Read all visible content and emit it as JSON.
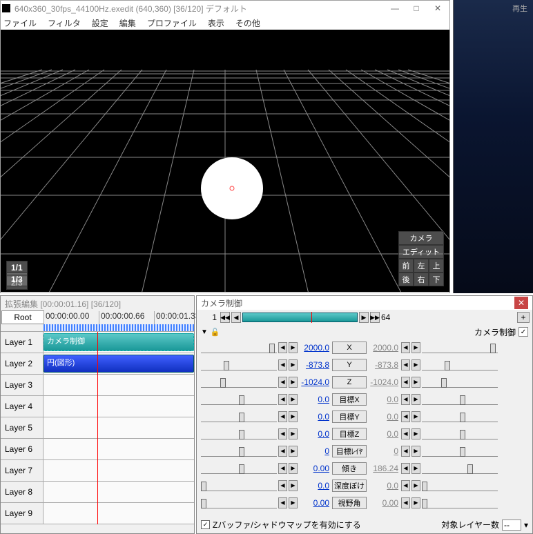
{
  "main": {
    "title": "640x360_30fps_44100Hz.exedit (640,360) [36/120] デフォルト",
    "menu": {
      "file": "ファイル",
      "filter": "フィルタ",
      "settings": "設定",
      "edit": "編集",
      "profile": "プロファイル",
      "view": "表示",
      "other": "その他"
    }
  },
  "side": {
    "label": "再生"
  },
  "viewport": {
    "badges_left": [
      "1/1",
      "2/3",
      "1/3"
    ],
    "camera_label": "カメラ",
    "edit_label": "エディット",
    "nav": {
      "front": "前",
      "left": "左",
      "top": "上",
      "back": "後",
      "right": "右",
      "bottom": "下"
    }
  },
  "timeline": {
    "title": "拡張編集 [00:00:01.16] [36/120]",
    "root": "Root",
    "ticks": [
      "00:00:00.00",
      "00:00:00.66",
      "00:00:01.33"
    ],
    "layers": [
      "Layer 1",
      "Layer 2",
      "Layer 3",
      "Layer 4",
      "Layer 5",
      "Layer 6",
      "Layer 7",
      "Layer 8",
      "Layer 9"
    ],
    "clip_cam": "カメラ制御",
    "clip_shape": "円(図形)"
  },
  "panel": {
    "title": "カメラ制御",
    "frame_start": "1",
    "frame_end": "64",
    "sub_label": "カメラ制御",
    "params": [
      {
        "label": "X",
        "l": "2000.0",
        "r": "2000.0",
        "lg": false,
        "rg": true,
        "lp": 90,
        "rp": 90
      },
      {
        "label": "Y",
        "l": "-873.8",
        "r": "-873.8",
        "lg": false,
        "rg": true,
        "lp": 30,
        "rp": 30
      },
      {
        "label": "Z",
        "l": "-1024.0",
        "r": "-1024.0",
        "lg": false,
        "rg": true,
        "lp": 25,
        "rp": 25
      },
      {
        "label": "目標X",
        "l": "0.0",
        "r": "0.0",
        "lg": false,
        "rg": true,
        "lp": 50,
        "rp": 50
      },
      {
        "label": "目標Y",
        "l": "0.0",
        "r": "0.0",
        "lg": false,
        "rg": true,
        "lp": 50,
        "rp": 50
      },
      {
        "label": "目標Z",
        "l": "0.0",
        "r": "0.0",
        "lg": false,
        "rg": true,
        "lp": 50,
        "rp": 50
      },
      {
        "label": "目標ﾚｲﾔ",
        "l": "0",
        "r": "0",
        "lg": false,
        "rg": true,
        "lp": 50,
        "rp": 50
      },
      {
        "label": "傾き",
        "l": "0.00",
        "r": "186.24",
        "lg": false,
        "rg": true,
        "lp": 50,
        "rp": 60
      },
      {
        "label": "深度ぼけ",
        "l": "0.0",
        "r": "0.0",
        "lg": false,
        "rg": true,
        "lp": 0,
        "rp": 0
      },
      {
        "label": "視野角",
        "l": "0.00",
        "r": "0.00",
        "lg": false,
        "rg": true,
        "lp": 0,
        "rp": 0
      }
    ],
    "zbuffer_label": "Zバッファ/シャドウマップを有効にする",
    "target_layer_label": "対象レイヤー数",
    "target_layer_val": "--"
  }
}
